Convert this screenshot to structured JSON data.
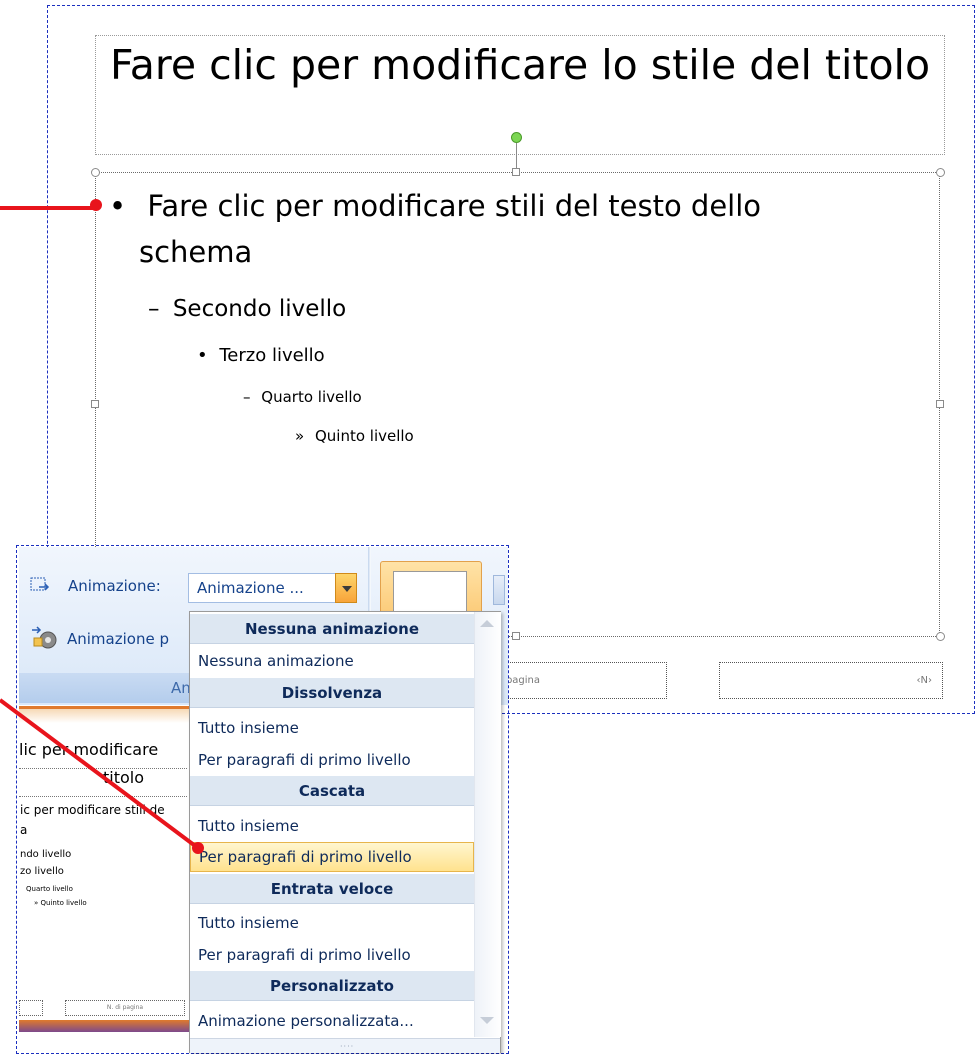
{
  "slide": {
    "title": "Fare clic per modificare lo stile del titolo",
    "levels": {
      "l1_line1": "Fare clic per modificare stili del testo dello",
      "l1_line2": "schema",
      "l2": "Secondo livello",
      "l3": "Terzo livello",
      "l4": "Quarto livello",
      "l5": "Quinto livello"
    },
    "bullets": {
      "l1": "•",
      "l2": "–",
      "l3": "•",
      "l4": "–",
      "l5": "»"
    },
    "footer": {
      "page_label": "i pagina",
      "number_label": "‹N›"
    }
  },
  "ribbon": {
    "animation_label": "Animazione:",
    "animation_value": "Animazione ...",
    "custom_label": "Animazione p",
    "group_label": "Anim"
  },
  "dropdown": {
    "groups": [
      {
        "header": "Nessuna animazione",
        "items": [
          "Nessuna animazione"
        ]
      },
      {
        "header": "Dissolvenza",
        "items": [
          "Tutto insieme",
          "Per paragrafi di primo livello"
        ]
      },
      {
        "header": "Cascata",
        "items": [
          "Tutto insieme",
          "Per paragrafi di primo livello"
        ]
      },
      {
        "header": "Entrata veloce",
        "items": [
          "Tutto insieme",
          "Per paragrafi di primo livello"
        ]
      },
      {
        "header": "Personalizzato",
        "items": [
          "Animazione personalizzata..."
        ]
      }
    ],
    "selected": "Cascata / Per paragrafi di primo livello"
  },
  "thumbnail": {
    "title_line1": "lic per modificare",
    "title_line2": "titolo",
    "body_line1": "ic per modificare stili de",
    "body_line2": "a",
    "second": "ndo livello",
    "third": "zo livello",
    "fourth": "Quarto livello",
    "fifth": "» Quinto livello",
    "footer_label": "N. di pagina"
  },
  "colors": {
    "accent_red": "#e8141c",
    "frame_blue": "#1b2fbf",
    "highlight": "#ffe28e"
  }
}
